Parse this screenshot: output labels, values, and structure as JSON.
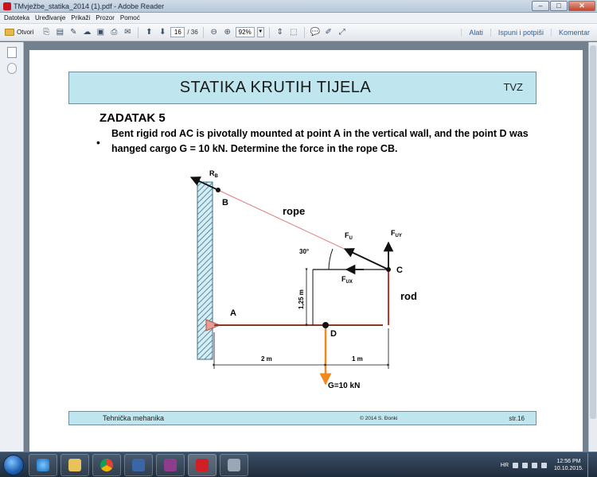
{
  "window": {
    "title": "TMvježbe_statika_2014 (1).pdf - Adobe Reader",
    "minimize_glyph": "–",
    "maximize_glyph": "□",
    "close_glyph": "✕"
  },
  "menu": [
    "Datoteka",
    "Uređivanje",
    "Prikaži",
    "Prozor",
    "Pomoć"
  ],
  "toolbar": {
    "open_label": "Otvori",
    "page_current": "16",
    "page_total": "/ 36",
    "zoom": "92%",
    "right_links": [
      "Alati",
      "Ispuni i potpiši",
      "Komentar"
    ]
  },
  "slide": {
    "header_title": "STATIKA KRUTIH TIJELA",
    "header_org": "TVZ",
    "task_title": "ZADATAK 5",
    "bullet": "•",
    "task_text": "Bent rigid rod AC is pivotally mounted at point A in the vertical wall, and the point D was hanged cargo G = 10 kN. Determine the force in the rope CB.",
    "footer_left": "Tehnička mehanika",
    "footer_mid": "© 2014 S. Đonki",
    "footer_right": "str.16"
  },
  "diagram": {
    "rb": "R",
    "rb_sub": "B",
    "point_b": "B",
    "rope": "rope",
    "fu": "F",
    "fu_sub": "U",
    "fuy": "F",
    "fuy_sub": "UY",
    "angle": "30°",
    "point_c": "C",
    "fux": "F",
    "fux_sub": "UX",
    "height": "1,25 m",
    "rod": "rod",
    "point_a": "A",
    "point_d": "D",
    "dim_left": "2 m",
    "dim_right": "1 m",
    "load": "G=10 kN"
  },
  "tray": {
    "lang": "HR",
    "time": "12:56 PM",
    "date": "10.10.2015."
  },
  "colors": {
    "header_bg": "#bfe6ee",
    "rope": "#e07a7a",
    "rod": "#8b3a2a",
    "load_arrow": "#f08a1c",
    "wall_hatch": "#4f8fa6"
  }
}
